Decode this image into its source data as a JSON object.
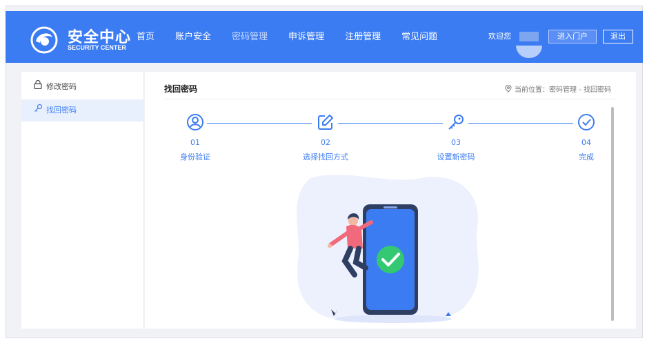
{
  "header": {
    "logo_title": "安全中心",
    "logo_subtitle": "SECURITY CENTER",
    "nav": [
      {
        "label": "首页"
      },
      {
        "label": "账户安全"
      },
      {
        "label": "密码管理"
      },
      {
        "label": "申诉管理"
      },
      {
        "label": "注册管理"
      },
      {
        "label": "常见问题"
      }
    ],
    "active_nav": "密码管理",
    "welcome": "欢迎您",
    "portal_button": "进入门户",
    "logout_button": "退出"
  },
  "sidebar": {
    "items": [
      {
        "label": "修改密码",
        "icon": "lock-icon"
      },
      {
        "label": "找回密码",
        "icon": "key-icon"
      }
    ],
    "active_item": "找回密码"
  },
  "main": {
    "title": "找回密码",
    "breadcrumb": "当前位置：密码管理 - 找回密码",
    "steps": [
      {
        "num": "01",
        "label": "身份验证",
        "icon": "user-icon"
      },
      {
        "num": "02",
        "label": "选择找回方式",
        "icon": "edit-icon"
      },
      {
        "num": "03",
        "label": "设置新密码",
        "icon": "key-icon"
      },
      {
        "num": "04",
        "label": "完成",
        "icon": "check-circle-icon"
      }
    ]
  },
  "colors": {
    "primary": "#3c7cf3",
    "success": "#34c873",
    "accent_pink": "#f06a7b"
  }
}
